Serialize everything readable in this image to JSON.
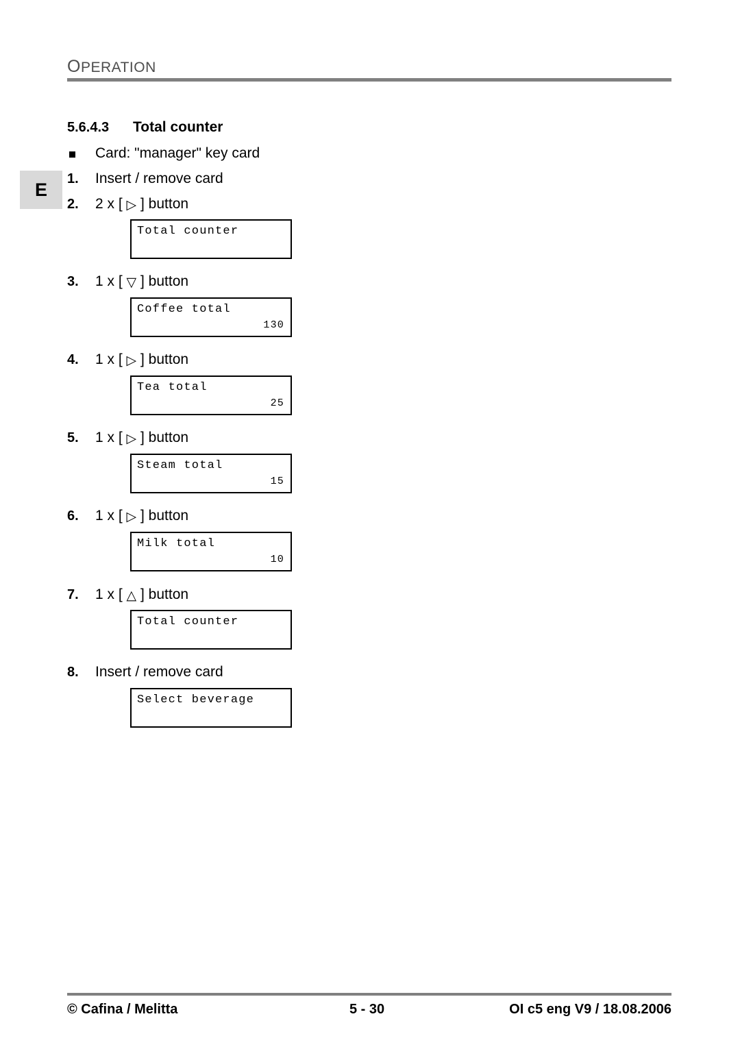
{
  "header": {
    "chapter_title_first": "O",
    "chapter_title_rest": "PERATION",
    "language_tab": "E"
  },
  "section": {
    "number": "5.6.4.3",
    "title": "Total counter"
  },
  "bullet": {
    "text": "Card: \"manager\" key card"
  },
  "steps": [
    {
      "num": "1.",
      "text": "Insert / remove card"
    },
    {
      "num": "2.",
      "prefix": "2 x [",
      "glyph": "▷",
      "suffix": "] button"
    },
    {
      "num": "3.",
      "prefix": "1 x [",
      "glyph": "▽",
      "suffix": "] button"
    },
    {
      "num": "4.",
      "prefix": "1 x [",
      "glyph": "▷",
      "suffix": "] button"
    },
    {
      "num": "5.",
      "prefix": "1 x [",
      "glyph": "▷",
      "suffix": "] button"
    },
    {
      "num": "6.",
      "prefix": "1 x [",
      "glyph": "▷",
      "suffix": "] button"
    },
    {
      "num": "7.",
      "prefix": "1 x [",
      "glyph": "△",
      "suffix": "] button"
    },
    {
      "num": "8.",
      "text": "Insert / remove card"
    }
  ],
  "displays": [
    {
      "line1": "Total counter",
      "line2": ""
    },
    {
      "line1": "Coffee total",
      "line2": "130"
    },
    {
      "line1": "Tea total",
      "line2": "25"
    },
    {
      "line1": "Steam total",
      "line2": "15"
    },
    {
      "line1": "Milk total",
      "line2": "10"
    },
    {
      "line1": "Total counter",
      "line2": ""
    },
    {
      "line1": "Select beverage",
      "line2": ""
    }
  ],
  "footer": {
    "left": "© Cafina / Melitta",
    "center": "5 - 30",
    "right": "OI c5 eng V9 / 18.08.2006"
  }
}
